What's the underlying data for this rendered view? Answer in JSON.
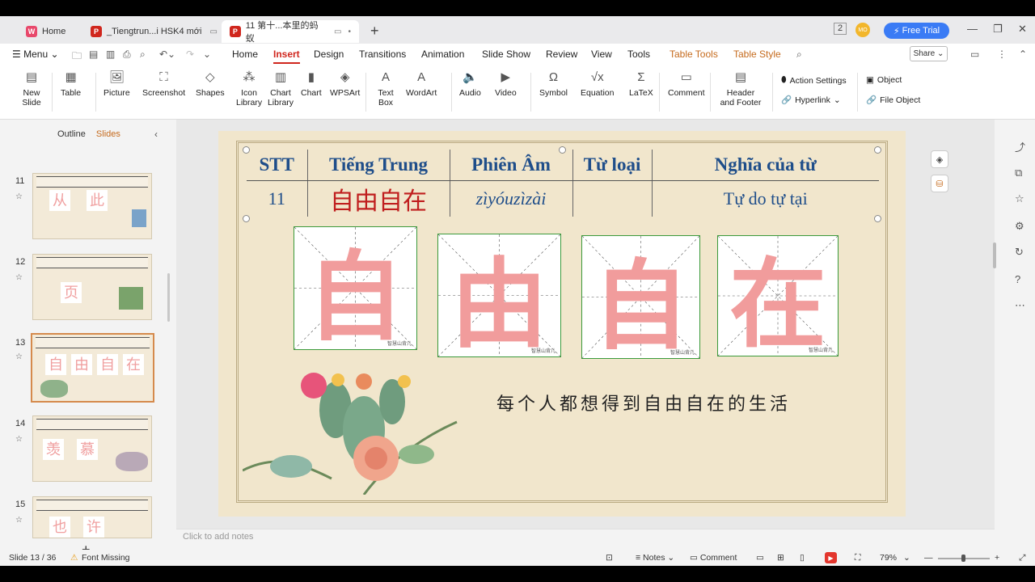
{
  "tabs": [
    {
      "label": "Home"
    },
    {
      "label": "_Tiengtrun...i HSK4 mới"
    },
    {
      "label": "11 第十...本里的蚂蚁"
    }
  ],
  "free_trial": "Free Trial",
  "avatar_text": "MO",
  "menu": {
    "menu_label": "Menu",
    "items": [
      "Home",
      "Insert",
      "Design",
      "Transitions",
      "Animation",
      "Slide Show",
      "Review",
      "View",
      "Tools",
      "Table Tools",
      "Table Style"
    ],
    "share": "Share"
  },
  "ribbon": {
    "new_slide": "New Slide",
    "table": "Table",
    "picture": "Picture",
    "screenshot": "Screenshot",
    "shapes": "Shapes",
    "icon_library": "Icon Library",
    "chart_library": "Chart Library",
    "chart": "Chart",
    "wpsart": "WPSArt",
    "text_box": "Text Box",
    "wordart": "WordArt",
    "audio": "Audio",
    "video": "Video",
    "symbol": "Symbol",
    "equation": "Equation",
    "latex": "LaTeX",
    "comment": "Comment",
    "header_footer": "Header and Footer",
    "action_settings": "Action Settings",
    "hyperlink": "Hyperlink",
    "object": "Object",
    "file_object": "File Object"
  },
  "left_panel": {
    "outline_tab": "Outline",
    "slides_tab": "Slides",
    "thumbnails": [
      {
        "number": "11",
        "chars": [
          "从",
          "此"
        ]
      },
      {
        "number": "12",
        "chars": [
          "页"
        ]
      },
      {
        "number": "13",
        "chars": [
          "自",
          "由",
          "自",
          "在"
        ]
      },
      {
        "number": "14",
        "chars": [
          "羡",
          "慕"
        ]
      },
      {
        "number": "15",
        "chars": [
          "也",
          "许"
        ]
      }
    ]
  },
  "slide": {
    "headers": [
      "STT",
      "Tiếng Trung",
      "Phiên Âm",
      "Từ loại",
      "Nghĩa của từ"
    ],
    "row": {
      "stt": "11",
      "chinese": "自由自在",
      "pinyin": "zìyóuzìzài",
      "word_type": "",
      "meaning": "Tự do tự tại"
    },
    "characters": [
      "自",
      "由",
      "自",
      "在"
    ],
    "watermark": "智慧山背儿",
    "sentence": "每个人都想得到自由自在的生活"
  },
  "notes_placeholder": "Click to add notes",
  "status": {
    "slide_info": "Slide 13 / 36",
    "font_missing": "Font Missing",
    "notes": "Notes",
    "comment": "Comment",
    "zoom": "79%"
  }
}
